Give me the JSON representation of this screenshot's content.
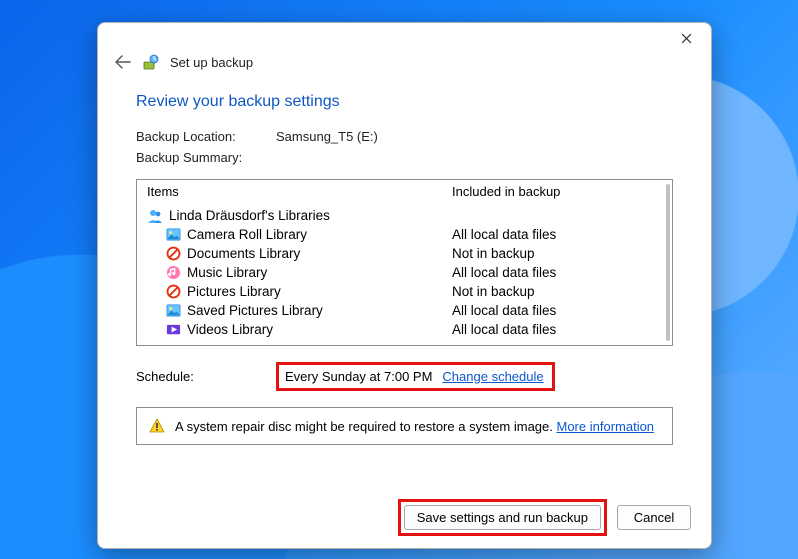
{
  "header": {
    "title": "Set up backup"
  },
  "heading": "Review your backup settings",
  "location": {
    "label": "Backup Location:",
    "value": "Samsung_T5 (E:)"
  },
  "summary": {
    "label": "Backup Summary:",
    "col_items": "Items",
    "col_included": "Included in backup",
    "group": {
      "icon": "users-icon",
      "label": "Linda Dräusdorf's Libraries"
    },
    "rows": [
      {
        "icon": "photo-icon",
        "label": "Camera Roll Library",
        "included": "All local data files"
      },
      {
        "icon": "deny-icon",
        "label": "Documents Library",
        "included": "Not in backup"
      },
      {
        "icon": "music-icon",
        "label": "Music Library",
        "included": "All local data files"
      },
      {
        "icon": "deny-icon",
        "label": "Pictures Library",
        "included": "Not in backup"
      },
      {
        "icon": "photo-icon",
        "label": "Saved Pictures Library",
        "included": "All local data files"
      },
      {
        "icon": "video-icon",
        "label": "Videos Library",
        "included": "All local data files"
      }
    ]
  },
  "schedule": {
    "label": "Schedule:",
    "value": "Every Sunday at 7:00 PM",
    "link": "Change schedule"
  },
  "warning": {
    "text": "A system repair disc might be required to restore a system image. ",
    "link": "More information"
  },
  "footer": {
    "save": "Save settings and run backup",
    "cancel": "Cancel"
  }
}
